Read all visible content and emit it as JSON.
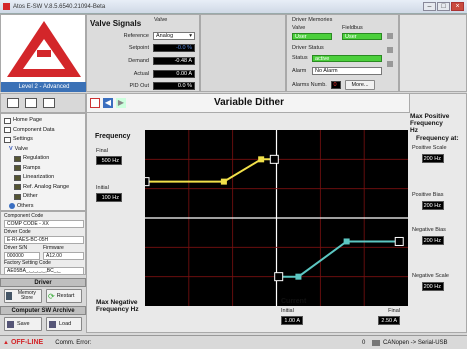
{
  "window": {
    "title": "Atos E-SW V.8.5.6540.21094-Beta"
  },
  "sidebar": {
    "level_label": "Level 2 - Advanced",
    "tree": [
      "Home Page",
      "Component Data",
      "Settings",
      "Valve",
      "Regulation",
      "Ramps",
      "Linearization",
      "Ref. Analog Range",
      "Dither",
      "Others"
    ],
    "component_code_label": "Component Code",
    "component_code": "COMP CODE - XX",
    "driver_code_label": "Driver Code",
    "driver_code": "E-RI-AES-BC-05H",
    "driver_sn_label": "Driver S/N",
    "firmware_label": "Firmware",
    "driver_sn": "000000",
    "firmware": "A12.00",
    "factory_label": "Factory Setting Code",
    "factory_code": "AE05BA_,_,_,_,_,BC_,_",
    "driver_header": "Driver",
    "memory_store": "Memory Store",
    "restart": "Restart",
    "archive_header": "Computer SW Archive",
    "save": "Save",
    "load": "Load"
  },
  "valve_signals": {
    "title": "Valve Signals",
    "valve_col": "Valve",
    "reference_label": "Reference",
    "reference_value": "Analog",
    "setpoint_label": "Setpoint",
    "setpoint_value": "-0.0 %",
    "demand_label": "Demand",
    "demand_value": "-0.48 A",
    "actual_label": "Actual",
    "actual_value": "0.00 A",
    "pid_label": "PID Out",
    "pid_value": "0.0 %"
  },
  "driver_memories": {
    "title": "Driver Memories",
    "valve_label": "Valve",
    "fieldbus_label": "Fieldbus",
    "valve_value": "User",
    "fieldbus_value": "User",
    "status_title": "Driver Status",
    "status_label": "Status",
    "status_value": "active",
    "alarm_label": "Alarm",
    "alarm_value": "No Alarm",
    "alarms_numb_label": "Alarms Numb.",
    "alarms_numb_value": "0",
    "more_button": "More..."
  },
  "page": {
    "title": "Variable Dither"
  },
  "frequency": {
    "title": "Frequency",
    "final_label": "Final",
    "final_value": "500 Hz",
    "initial_label": "Initial",
    "initial_value": "100 Hz"
  },
  "max_positive": "Max Positive Frequency Hz",
  "frequency_at": "Frequency at:",
  "positive_scale_label": "Positive Scale",
  "positive_scale_value": "200 Hz",
  "positive_bias_label": "Positive Bias",
  "positive_bias_value": "200 Hz",
  "negative_bias_label": "Negative Bias",
  "negative_bias_value": "200 Hz",
  "negative_scale_label": "Negative Scale",
  "negative_scale_value": "200 Hz",
  "max_negative": "Max Negative Frequency Hz",
  "current": {
    "title": "Current",
    "initial_label": "Initial",
    "final_label": "Final",
    "initial_value": "1.00 A",
    "final_value": "2.50 A"
  },
  "statusbar": {
    "offline": "OFF-LINE",
    "comm_error": "Comm. Error:",
    "port_count": "0",
    "port": "CANopen -> Serial-USB"
  },
  "colors": {
    "positive_line": "#f1e04a",
    "negative_line": "#5cc7c2",
    "accent_red": "#d3262a",
    "green": "#4ccf3c"
  },
  "chart_data": {
    "type": "line",
    "series": [
      {
        "values": [
          [
            -3,
            0.62
          ],
          [
            -1.2,
            0.62
          ],
          [
            -0.35,
            1.0
          ],
          [
            -0.05,
            1.0
          ]
        ]
      },
      {
        "values": [
          [
            0.05,
            -1.0
          ],
          [
            0.5,
            -1.0
          ],
          [
            1.6,
            -0.4
          ],
          [
            2.8,
            -0.4
          ]
        ]
      }
    ],
    "xlim": [
      -3,
      3
    ],
    "ylim": [
      -1.5,
      1.5
    ],
    "grid": true
  }
}
